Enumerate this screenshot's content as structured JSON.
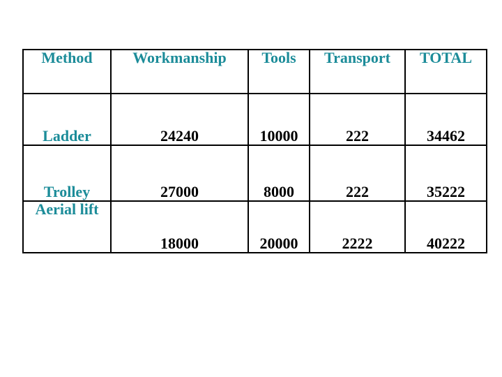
{
  "slide": {
    "background_color": "#ffffff",
    "header_text_color": "#1C8C99",
    "body_text_color": "#000000",
    "border_color": "#000000"
  },
  "table": {
    "headers": [
      "Method",
      "Workmanship",
      "Tools",
      "Transport",
      "TOTAL"
    ],
    "rows": [
      {
        "method": "Ladder",
        "workmanship": "24240",
        "tools": "10000",
        "transport": "222",
        "total": "34462"
      },
      {
        "method": "Trolley",
        "workmanship": "27000",
        "tools": "8000",
        "transport": "222",
        "total": "35222"
      },
      {
        "method": "Aerial lift",
        "workmanship": "18000",
        "tools": "20000",
        "transport": "2222",
        "total": "40222"
      }
    ]
  }
}
